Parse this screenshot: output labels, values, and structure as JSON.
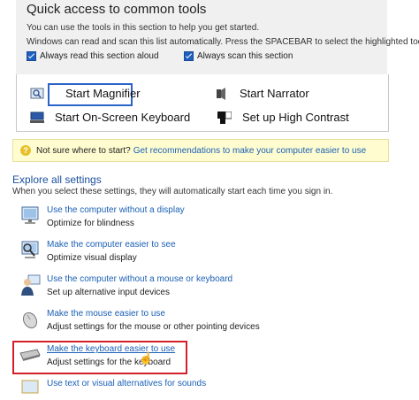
{
  "quick_access": {
    "title": "Quick access to common tools",
    "desc1": "You can use the tools in this section to help you get started.",
    "desc2": "Windows can read and scan this list automatically.  Press the SPACEBAR to select the highlighted tool.",
    "checkbox_read": "Always read this section aloud",
    "checkbox_scan": "Always scan this section"
  },
  "tools": {
    "magnifier": "Start Magnifier",
    "narrator": "Start Narrator",
    "osk": "Start On-Screen Keyboard",
    "contrast": "Set up High Contrast"
  },
  "hint": {
    "prefix": "Not sure where to start?",
    "link": "Get recommendations to make your computer easier to use"
  },
  "explore": {
    "title": "Explore all settings",
    "desc": "When you select these settings, they will automatically start each time you sign in."
  },
  "settings": [
    {
      "link": "Use the computer without a display",
      "desc": "Optimize for blindness"
    },
    {
      "link": "Make the computer easier to see",
      "desc": "Optimize visual display"
    },
    {
      "link": "Use the computer without a mouse or keyboard",
      "desc": "Set up alternative input devices"
    },
    {
      "link": "Make the mouse easier to use",
      "desc": "Adjust settings for the mouse or other pointing devices"
    },
    {
      "link": "Make the keyboard easier to use",
      "desc": "Adjust settings for the keyboard"
    },
    {
      "link": "Use text or visual alternatives for sounds",
      "desc": ""
    }
  ],
  "colors": {
    "link": "#1a5fb4",
    "highlight": "#d3202a",
    "accent": "#2b63c9"
  }
}
